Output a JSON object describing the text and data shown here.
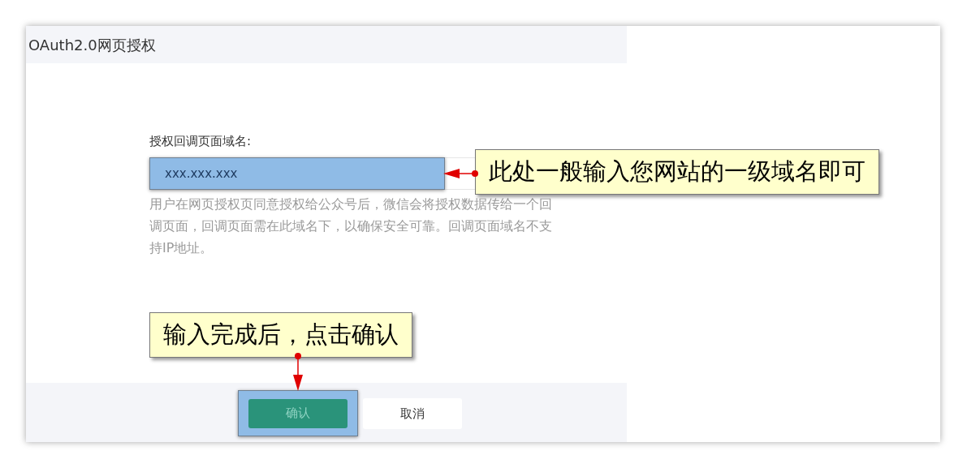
{
  "dialog": {
    "title": "OAuth2.0网页授权",
    "field": {
      "label": "授权回调页面域名:",
      "value": "xxx.xxx.xxx",
      "highlighted": true,
      "help": "用户在网页授权页同意授权给公众号后，微信会将授权数据传给一个回调页面，回调页面需在此域名下，以确保安全可靠。回调页面域名不支持IP地址。"
    },
    "buttons": [
      {
        "label": "确认",
        "kind": "primary",
        "highlighted": true
      },
      {
        "label": "取消",
        "kind": "default",
        "highlighted": false
      }
    ]
  },
  "callouts": [
    {
      "text": "此处一般输入您网站的一级域名即可",
      "kind": "left"
    },
    {
      "text": "输入完成后，点击确认",
      "kind": "down"
    }
  ]
}
